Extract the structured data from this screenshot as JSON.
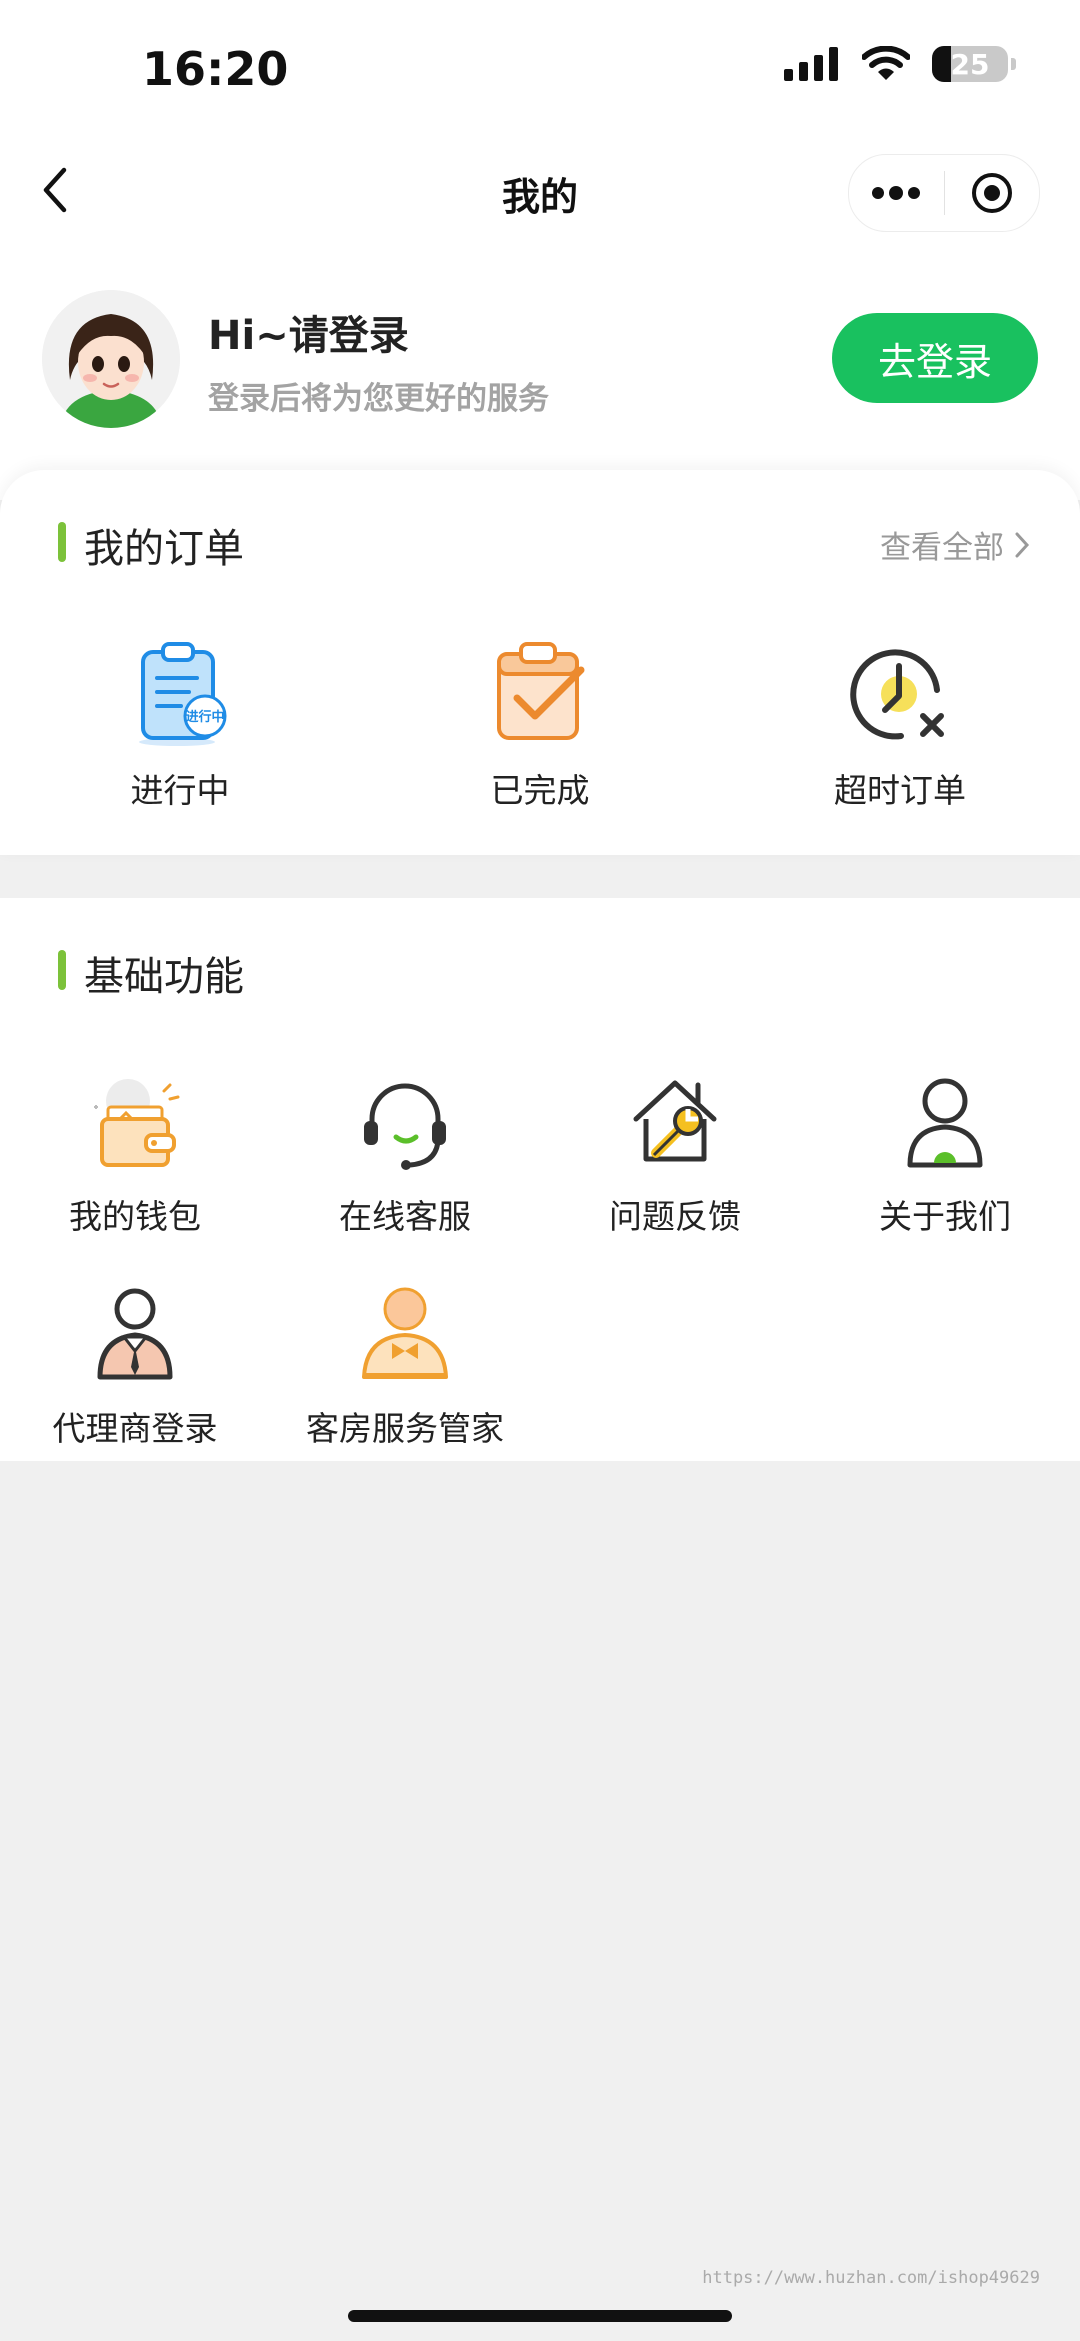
{
  "status_bar": {
    "time": "16:20",
    "battery": "25",
    "battery_percent": 25
  },
  "nav": {
    "title": "我的"
  },
  "profile": {
    "greeting": "Hi~请登录",
    "subtitle": "登录后将为您更好的服务",
    "login_button": "去登录"
  },
  "orders": {
    "title": "我的订单",
    "view_all": "查看全部",
    "items": [
      {
        "label": "进行中",
        "icon": "clipboard-icon",
        "badge": "进行中"
      },
      {
        "label": "已完成",
        "icon": "clipboard-check-icon"
      },
      {
        "label": "超时订单",
        "icon": "clock-cancel-icon"
      }
    ]
  },
  "basic": {
    "title": "基础功能",
    "items": [
      {
        "label": "我的钱包",
        "icon": "wallet-icon"
      },
      {
        "label": "在线客服",
        "icon": "headset-icon"
      },
      {
        "label": "问题反馈",
        "icon": "house-wrench-icon"
      },
      {
        "label": "关于我们",
        "icon": "user-icon"
      },
      {
        "label": "代理商登录",
        "icon": "agent-icon"
      },
      {
        "label": "客房服务管家",
        "icon": "butler-icon"
      }
    ]
  },
  "watermark": "https://www.huzhan.com/ishop49629",
  "colors": {
    "accent_green": "#19c15f",
    "section_bar": "#7cc23a",
    "orange": "#f0a030"
  }
}
